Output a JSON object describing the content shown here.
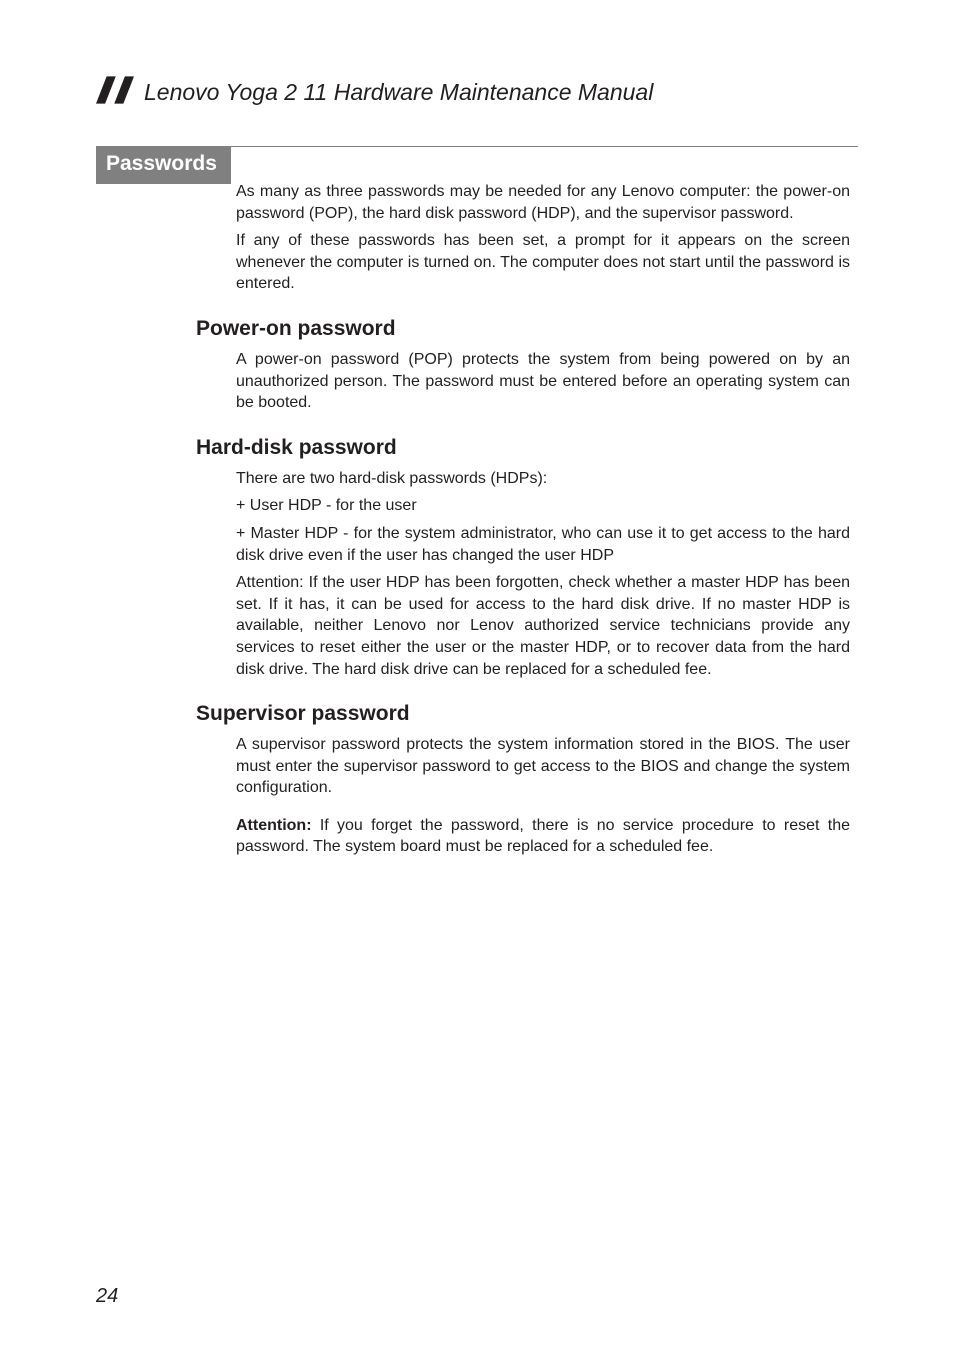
{
  "header": {
    "title": "Lenovo Yoga 2 11 Hardware Maintenance Manual"
  },
  "section": {
    "title": "Passwords",
    "intro1": "As many as three passwords may be needed for any Lenovo computer: the power-on password (POP), the hard disk password (HDP), and the supervisor password.",
    "intro2": "If any of these passwords has been set, a prompt for it appears on the screen whenever the computer is turned on. The computer does not start until the password is entered."
  },
  "sub1": {
    "heading": "Power-on password",
    "p1": "A power-on password (POP) protects the system from being powered on by an unauthorized person. The password must be entered before an operating system can be booted."
  },
  "sub2": {
    "heading": "Hard-disk password",
    "p1": "There are two hard-disk passwords (HDPs):",
    "bullet1": "+ User HDP - for the user",
    "bullet2": "+ Master HDP - for the system administrator, who can use it to get access to the hard disk drive even if the user has changed the user HDP",
    "p2": "Attention: If the user HDP has been forgotten, check whether a master HDP has been set. If it has, it can be used for access to the hard disk drive. If no master HDP is available, neither Lenovo nor Lenov authorized service technicians provide any services to reset either the user or the master HDP, or to recover data from the hard disk drive. The hard disk drive can be replaced for a scheduled fee."
  },
  "sub3": {
    "heading": "Supervisor password",
    "p1": "A supervisor password protects the system information stored in the BIOS. The user must enter the supervisor password to get access to the BIOS and change the system configuration.",
    "attn_label": "Attention:",
    "attn_body": " If you forget the password, there is no service procedure to reset the password. The system board must be replaced for a scheduled fee."
  },
  "page_number": "24"
}
